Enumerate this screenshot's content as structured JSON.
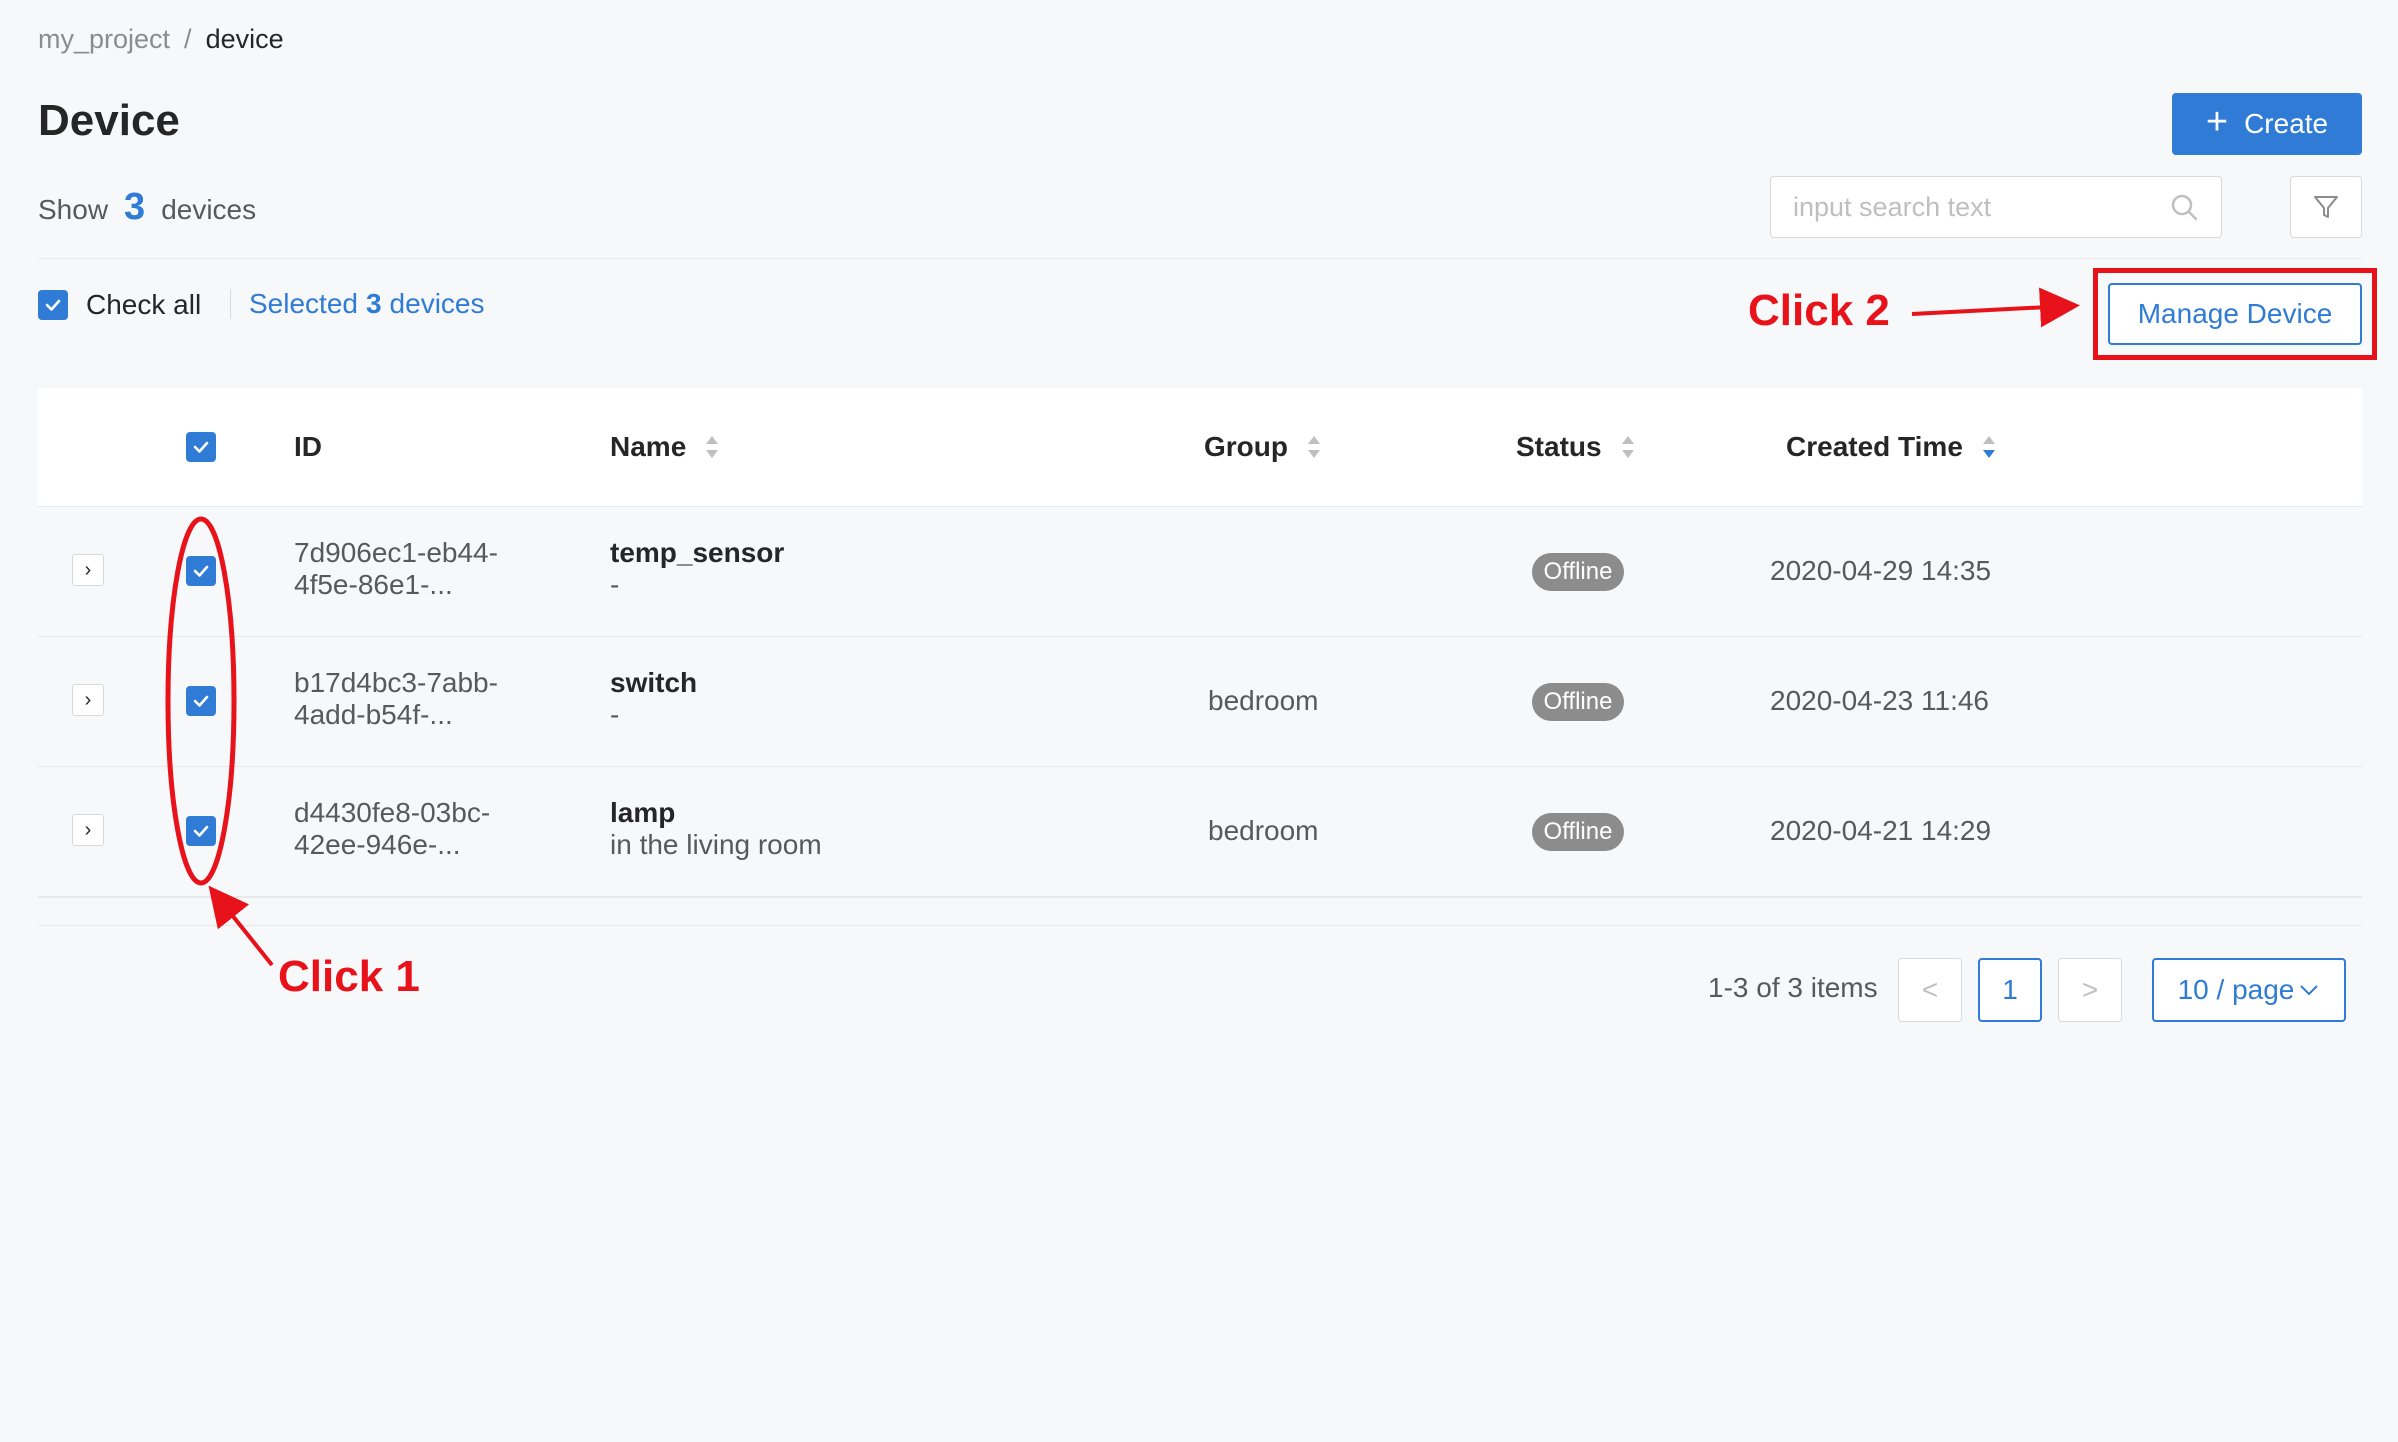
{
  "breadcrumb": {
    "project": "my_project",
    "separator": "/",
    "current": "device"
  },
  "page": {
    "title": "Device"
  },
  "toolbar": {
    "create_label": "Create"
  },
  "summary": {
    "prefix": "Show",
    "count": "3",
    "suffix": "devices"
  },
  "search": {
    "placeholder": "input search text"
  },
  "selection": {
    "check_all_label": "Check all",
    "selected_prefix": "Selected",
    "selected_count": "3",
    "selected_suffix": "devices",
    "manage_label": "Manage Device"
  },
  "table": {
    "columns": {
      "id": "ID",
      "name": "Name",
      "group": "Group",
      "status": "Status",
      "created": "Created Time"
    },
    "rows": [
      {
        "id_line1": "7d906ec1-eb44-",
        "id_line2": "4f5e-86e1-...",
        "name": "temp_sensor",
        "description": "-",
        "group": "",
        "status": "Offline",
        "created": "2020-04-29 14:35"
      },
      {
        "id_line1": "b17d4bc3-7abb-",
        "id_line2": "4add-b54f-...",
        "name": "switch",
        "description": "-",
        "group": "bedroom",
        "status": "Offline",
        "created": "2020-04-23 11:46"
      },
      {
        "id_line1": "d4430fe8-03bc-",
        "id_line2": "42ee-946e-...",
        "name": "lamp",
        "description": "in the living room",
        "group": "bedroom",
        "status": "Offline",
        "created": "2020-04-21 14:29"
      }
    ]
  },
  "pagination": {
    "total": "1-3 of 3 items",
    "prev": "<",
    "current": "1",
    "next": ">",
    "page_size": "10 / page"
  },
  "annotations": {
    "click1": "Click 1",
    "click2": "Click 2",
    "color": "#e8121b"
  },
  "colors": {
    "primary": "#2f7bd6",
    "status_offline": "#8c8c8c"
  }
}
